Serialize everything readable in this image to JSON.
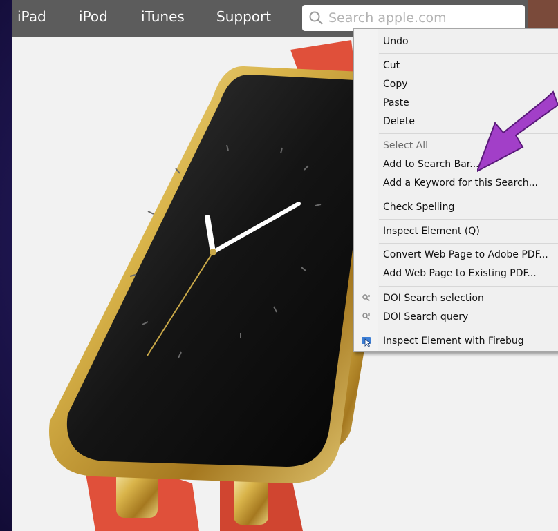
{
  "nav": {
    "items": [
      "iPad",
      "iPod",
      "iTunes",
      "Support"
    ],
    "search_placeholder": "Search apple.com"
  },
  "context_menu": {
    "items": [
      {
        "label": "Undo",
        "disabled": false
      },
      {
        "label": "Cut",
        "disabled": false
      },
      {
        "label": "Copy",
        "disabled": false
      },
      {
        "label": "Paste",
        "disabled": false
      },
      {
        "label": "Delete",
        "disabled": false
      },
      {
        "label": "Select All",
        "disabled": true
      },
      {
        "label": "Add to Search Bar...",
        "disabled": false
      },
      {
        "label": "Add a Keyword for this Search...",
        "disabled": false
      },
      {
        "label": "Check Spelling",
        "disabled": false
      },
      {
        "label": "Inspect Element (Q)",
        "disabled": false
      },
      {
        "label": "Convert Web Page to Adobe PDF...",
        "disabled": false
      },
      {
        "label": "Add Web Page to Existing PDF...",
        "disabled": false
      },
      {
        "label": "DOI Search selection",
        "disabled": false,
        "icon": "doi-icon"
      },
      {
        "label": "DOI Search query",
        "disabled": false,
        "icon": "doi-icon"
      },
      {
        "label": "Inspect Element with Firebug",
        "disabled": false,
        "icon": "firebug-icon"
      }
    ]
  },
  "colors": {
    "background": "#241a5c",
    "navbar": "#5c5c5c",
    "annotation_arrow": "#9b3fc4",
    "watch_gold": "#d9b44a",
    "watch_strap": "#e0503a"
  }
}
